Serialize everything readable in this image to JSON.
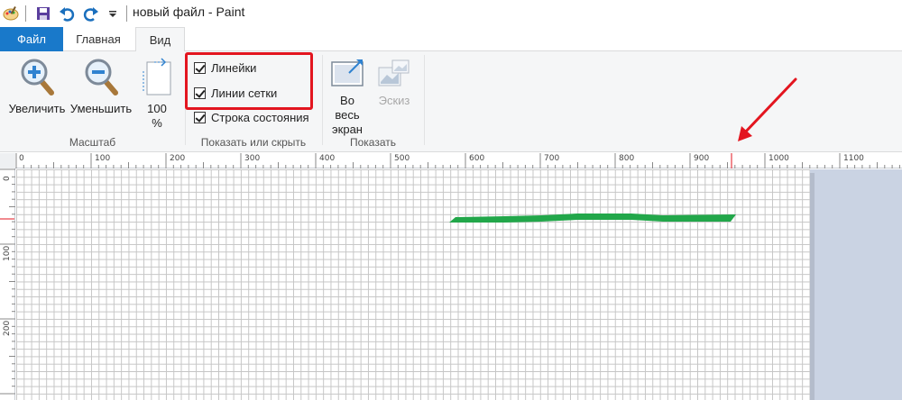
{
  "titlebar": {
    "title": "новый файл - Paint",
    "icons": [
      "paint-app-icon",
      "save-icon",
      "undo-icon",
      "redo-icon",
      "customize-dropdown-icon"
    ]
  },
  "tabs": [
    {
      "label": "Файл",
      "active": false
    },
    {
      "label": "Главная",
      "active": false
    },
    {
      "label": "Вид",
      "active": true
    }
  ],
  "ribbon": {
    "zoom_group": {
      "label": "Масштаб",
      "zoom_in": "Увеличить",
      "zoom_out": "Уменьшить",
      "hundred_line1": "100",
      "hundred_line2": "%"
    },
    "show_group": {
      "label": "Показать или скрыть",
      "rulers": {
        "label": "Линейки",
        "checked": true
      },
      "gridlines": {
        "label": "Линии сетки",
        "checked": true
      },
      "statusbar": {
        "label": "Строка состояния",
        "checked": true
      }
    },
    "display_group": {
      "label": "Показать",
      "fullscreen_line1": "Во весь",
      "fullscreen_line2": "экран",
      "thumbnail": "Эскиз",
      "thumbnail_enabled": false
    }
  },
  "ruler": {
    "h_labels": [
      "0",
      "100",
      "200",
      "300",
      "400",
      "500",
      "600",
      "700",
      "800",
      "900",
      "1000",
      "1100"
    ],
    "v_labels": [
      "0",
      "100",
      "200"
    ]
  },
  "colors": {
    "accent": "#1979ca",
    "highlight": "#e3151f",
    "stroke": "#22a74a",
    "ruler_marker": "#e3151f"
  }
}
